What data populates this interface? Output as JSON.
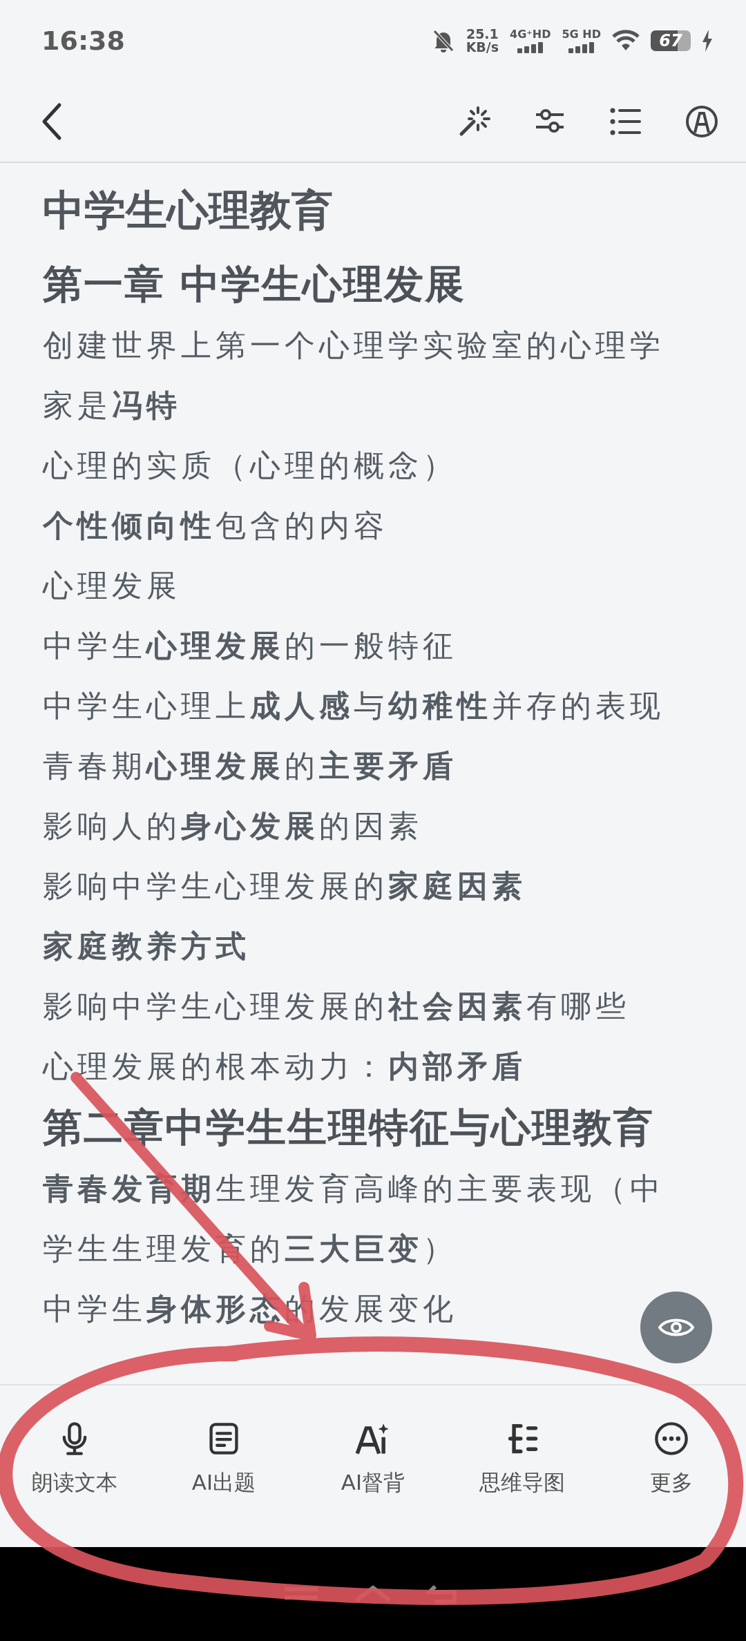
{
  "status_bar": {
    "time": "16:38",
    "speed_value": "25.1",
    "speed_unit": "KB/s",
    "network_1": "4G⁺HD",
    "network_2": "5G HD",
    "battery": "67",
    "charging": true
  },
  "content": [
    {
      "kind": "title",
      "text": "中学生心理教育"
    },
    {
      "kind": "heading",
      "text": "第一章  中学生**心理发展**"
    },
    {
      "kind": "line",
      "text": "创建世界上第一个心理学实验室的心理学家是**冯特**"
    },
    {
      "kind": "line",
      "text": "心理的实质（心理的概念）"
    },
    {
      "kind": "line",
      "text": "**个性倾向性**包含的内容"
    },
    {
      "kind": "line",
      "text": "心理发展"
    },
    {
      "kind": "line",
      "text": "中学生**心理发展**的一般特征"
    },
    {
      "kind": "line",
      "text": "中学生心理上**成人感**与**幼稚性**并存的表现"
    },
    {
      "kind": "line",
      "text": "青春期**心理发展**的**主要矛盾**"
    },
    {
      "kind": "line",
      "text": "影响人的**身心发展**的因素"
    },
    {
      "kind": "line",
      "text": "影响中学生心理发展的**家庭因素**"
    },
    {
      "kind": "line",
      "text": "**家庭教养方式**"
    },
    {
      "kind": "line",
      "text": "影响中学生心理发展的**社会因素**有哪些"
    },
    {
      "kind": "line",
      "text": "心理发展的根本动力：**内部矛盾**"
    },
    {
      "kind": "heading",
      "text": "第二章中学生生理特征与心理教育"
    },
    {
      "kind": "line",
      "text": "**青春发育期**生理发育高峰的主要表现（中学生生理发育的**三大巨变**）"
    },
    {
      "kind": "line",
      "text": "中学生**身体形态**的发展变化"
    }
  ],
  "tools": [
    {
      "kind": "mic",
      "label": "朗读文本"
    },
    {
      "kind": "doc",
      "label": "AI出题"
    },
    {
      "kind": "ai",
      "label": "AI督背"
    },
    {
      "kind": "mindmap",
      "label": "思维导图"
    },
    {
      "kind": "more",
      "label": "更多"
    }
  ],
  "annotation": {
    "kind": "arrow-and-circle"
  }
}
